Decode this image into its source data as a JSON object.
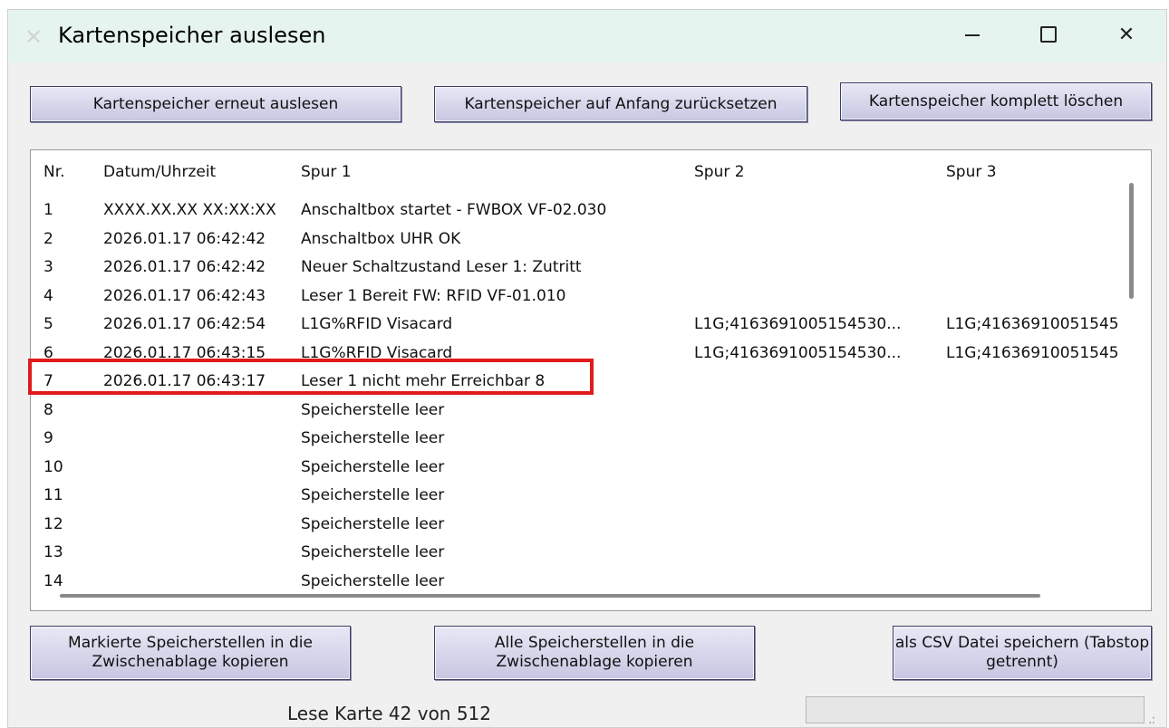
{
  "window": {
    "title": "Kartenspeicher auslesen",
    "controls": {
      "minimize": "—",
      "maximize": "☐",
      "close": "✕"
    }
  },
  "top_buttons": {
    "reread": "Kartenspeicher erneut auslesen",
    "reset": "Kartenspeicher auf Anfang zurücksetzen",
    "delete_all": "Kartenspeicher komplett löschen"
  },
  "table": {
    "columns": [
      "Nr.",
      "Datum/Uhrzeit",
      "Spur 1",
      "Spur 2",
      "Spur 3"
    ],
    "rows": [
      [
        "1",
        "XXXX.XX.XX XX:XX:XX",
        "Anschaltbox startet - FWBOX VF-02.030",
        "",
        ""
      ],
      [
        "2",
        "2026.01.17 06:42:42",
        "Anschaltbox UHR OK",
        "",
        ""
      ],
      [
        "3",
        "2026.01.17 06:42:42",
        "Neuer Schaltzustand Leser 1: Zutritt",
        "",
        ""
      ],
      [
        "4",
        "2026.01.17 06:42:43",
        "Leser 1 Bereit FW: RFID VF-01.010",
        "",
        ""
      ],
      [
        "5",
        "2026.01.17 06:42:54",
        "L1G%RFID Visacard",
        "L1G;4163691005154530...",
        "L1G;41636910051545"
      ],
      [
        "6",
        "2026.01.17 06:43:15",
        "L1G%RFID Visacard",
        "L1G;4163691005154530...",
        "L1G;41636910051545"
      ],
      [
        "7",
        "2026.01.17 06:43:17",
        "Leser 1 nicht mehr Erreichbar 8",
        "",
        ""
      ],
      [
        "8",
        "",
        "Speicherstelle leer",
        "",
        ""
      ],
      [
        "9",
        "",
        "Speicherstelle leer",
        "",
        ""
      ],
      [
        "10",
        "",
        "Speicherstelle leer",
        "",
        ""
      ],
      [
        "11",
        "",
        "Speicherstelle leer",
        "",
        ""
      ],
      [
        "12",
        "",
        "Speicherstelle leer",
        "",
        ""
      ],
      [
        "13",
        "",
        "Speicherstelle leer",
        "",
        ""
      ],
      [
        "14",
        "",
        "Speicherstelle leer",
        "",
        ""
      ]
    ],
    "highlighted_row": "7"
  },
  "bottom_buttons": {
    "copy_marked": "Markierte Speicherstellen in die Zwischenablage kopieren",
    "copy_all": "Alle Speicherstellen in die Zwischenablage kopieren",
    "save_csv": "als CSV Datei speichern (Tabstop getrennt)"
  },
  "status": {
    "text": "Lese Karte 42 von 512",
    "progress": 0
  },
  "colors": {
    "titlebar": "#e6f4ef",
    "button": "#c6c6e2",
    "highlight": "#e01b1b"
  }
}
